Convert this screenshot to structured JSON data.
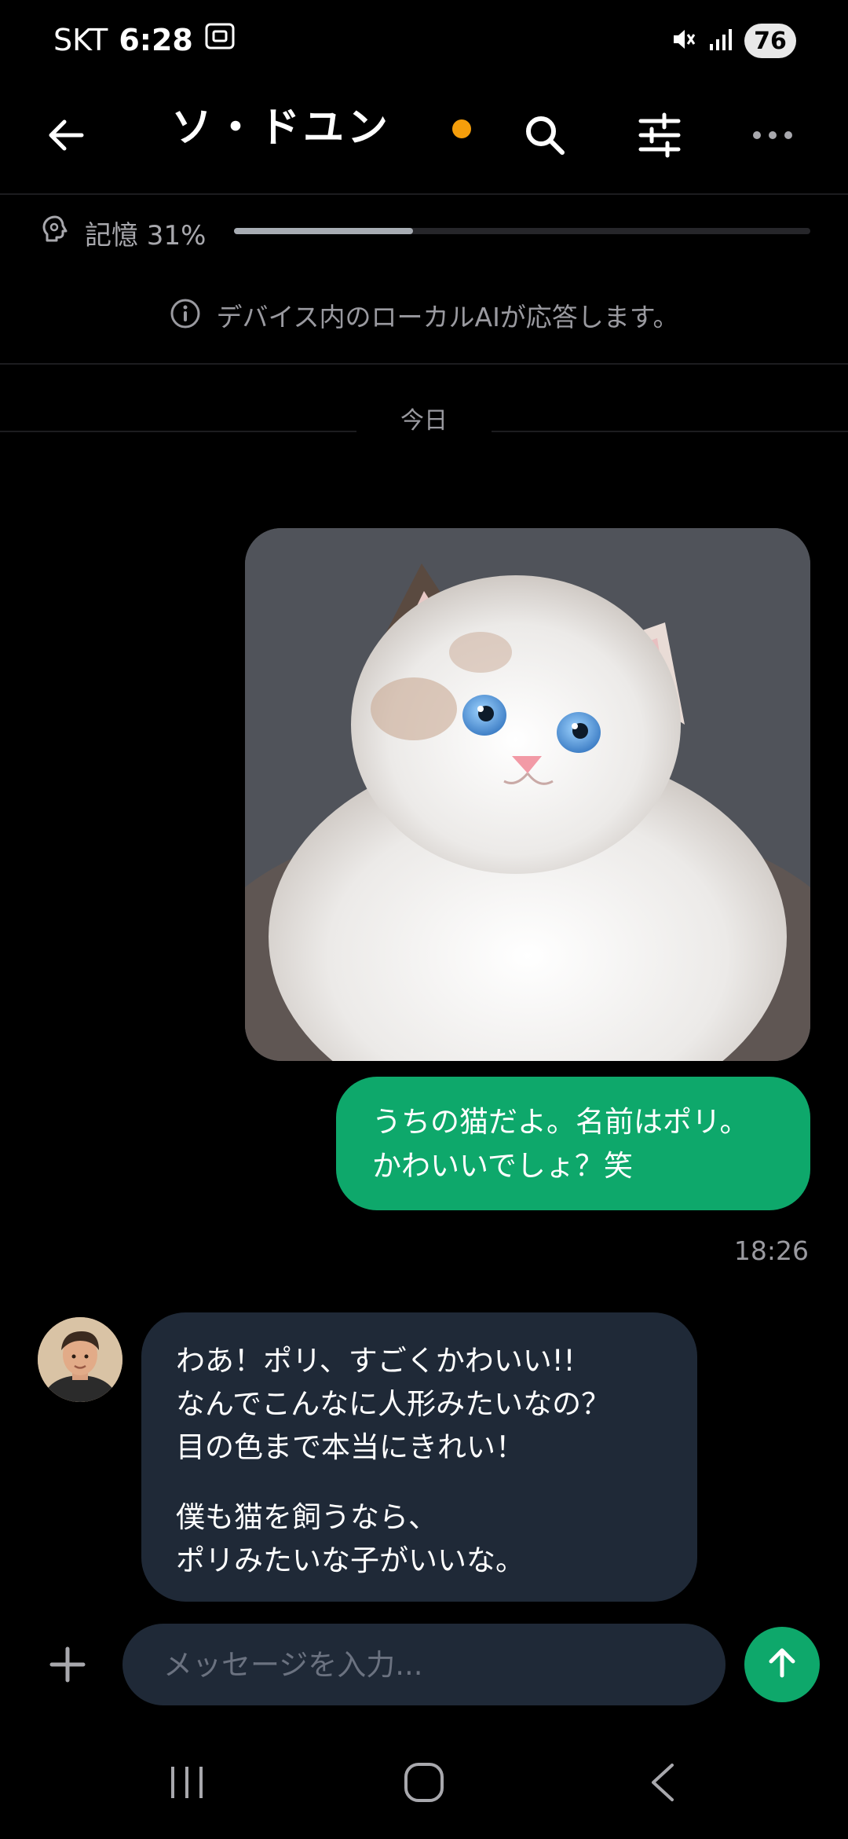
{
  "status_bar": {
    "carrier": "SKT",
    "time": "6:28",
    "battery": "76"
  },
  "header": {
    "title": "ソ・ドユン",
    "online_color": "#f59e0b"
  },
  "memory": {
    "label": "記憶 31%",
    "fill_fraction": 0.31
  },
  "notice": {
    "text": "デバイス内のローカルAIが応答します。"
  },
  "divider": {
    "date_label": "今日"
  },
  "messages": {
    "sent": {
      "lines": [
        "うちの猫だよ。名前はポリ。",
        "かわいいでしょ？笑"
      ],
      "time": "18:26",
      "color": "#0ea86b"
    },
    "received": {
      "lines": [
        "わあ！ポリ、すごくかわいい!!",
        "なんでこんなに人形みたいなの？",
        "目の色まで本当にきれい！",
        "僕も猫を飼うなら、",
        "ポリみたいな子がいいな。"
      ],
      "color": "#1f2937"
    }
  },
  "composer": {
    "placeholder": "メッセージを入力..."
  },
  "icons": {
    "back": "back-arrow-icon",
    "search": "search-icon",
    "filters": "sliders-icon",
    "more": "more-dots-icon",
    "memory": "brain-icon",
    "info": "info-icon",
    "add": "plus-icon",
    "send": "send-arrow-icon"
  }
}
